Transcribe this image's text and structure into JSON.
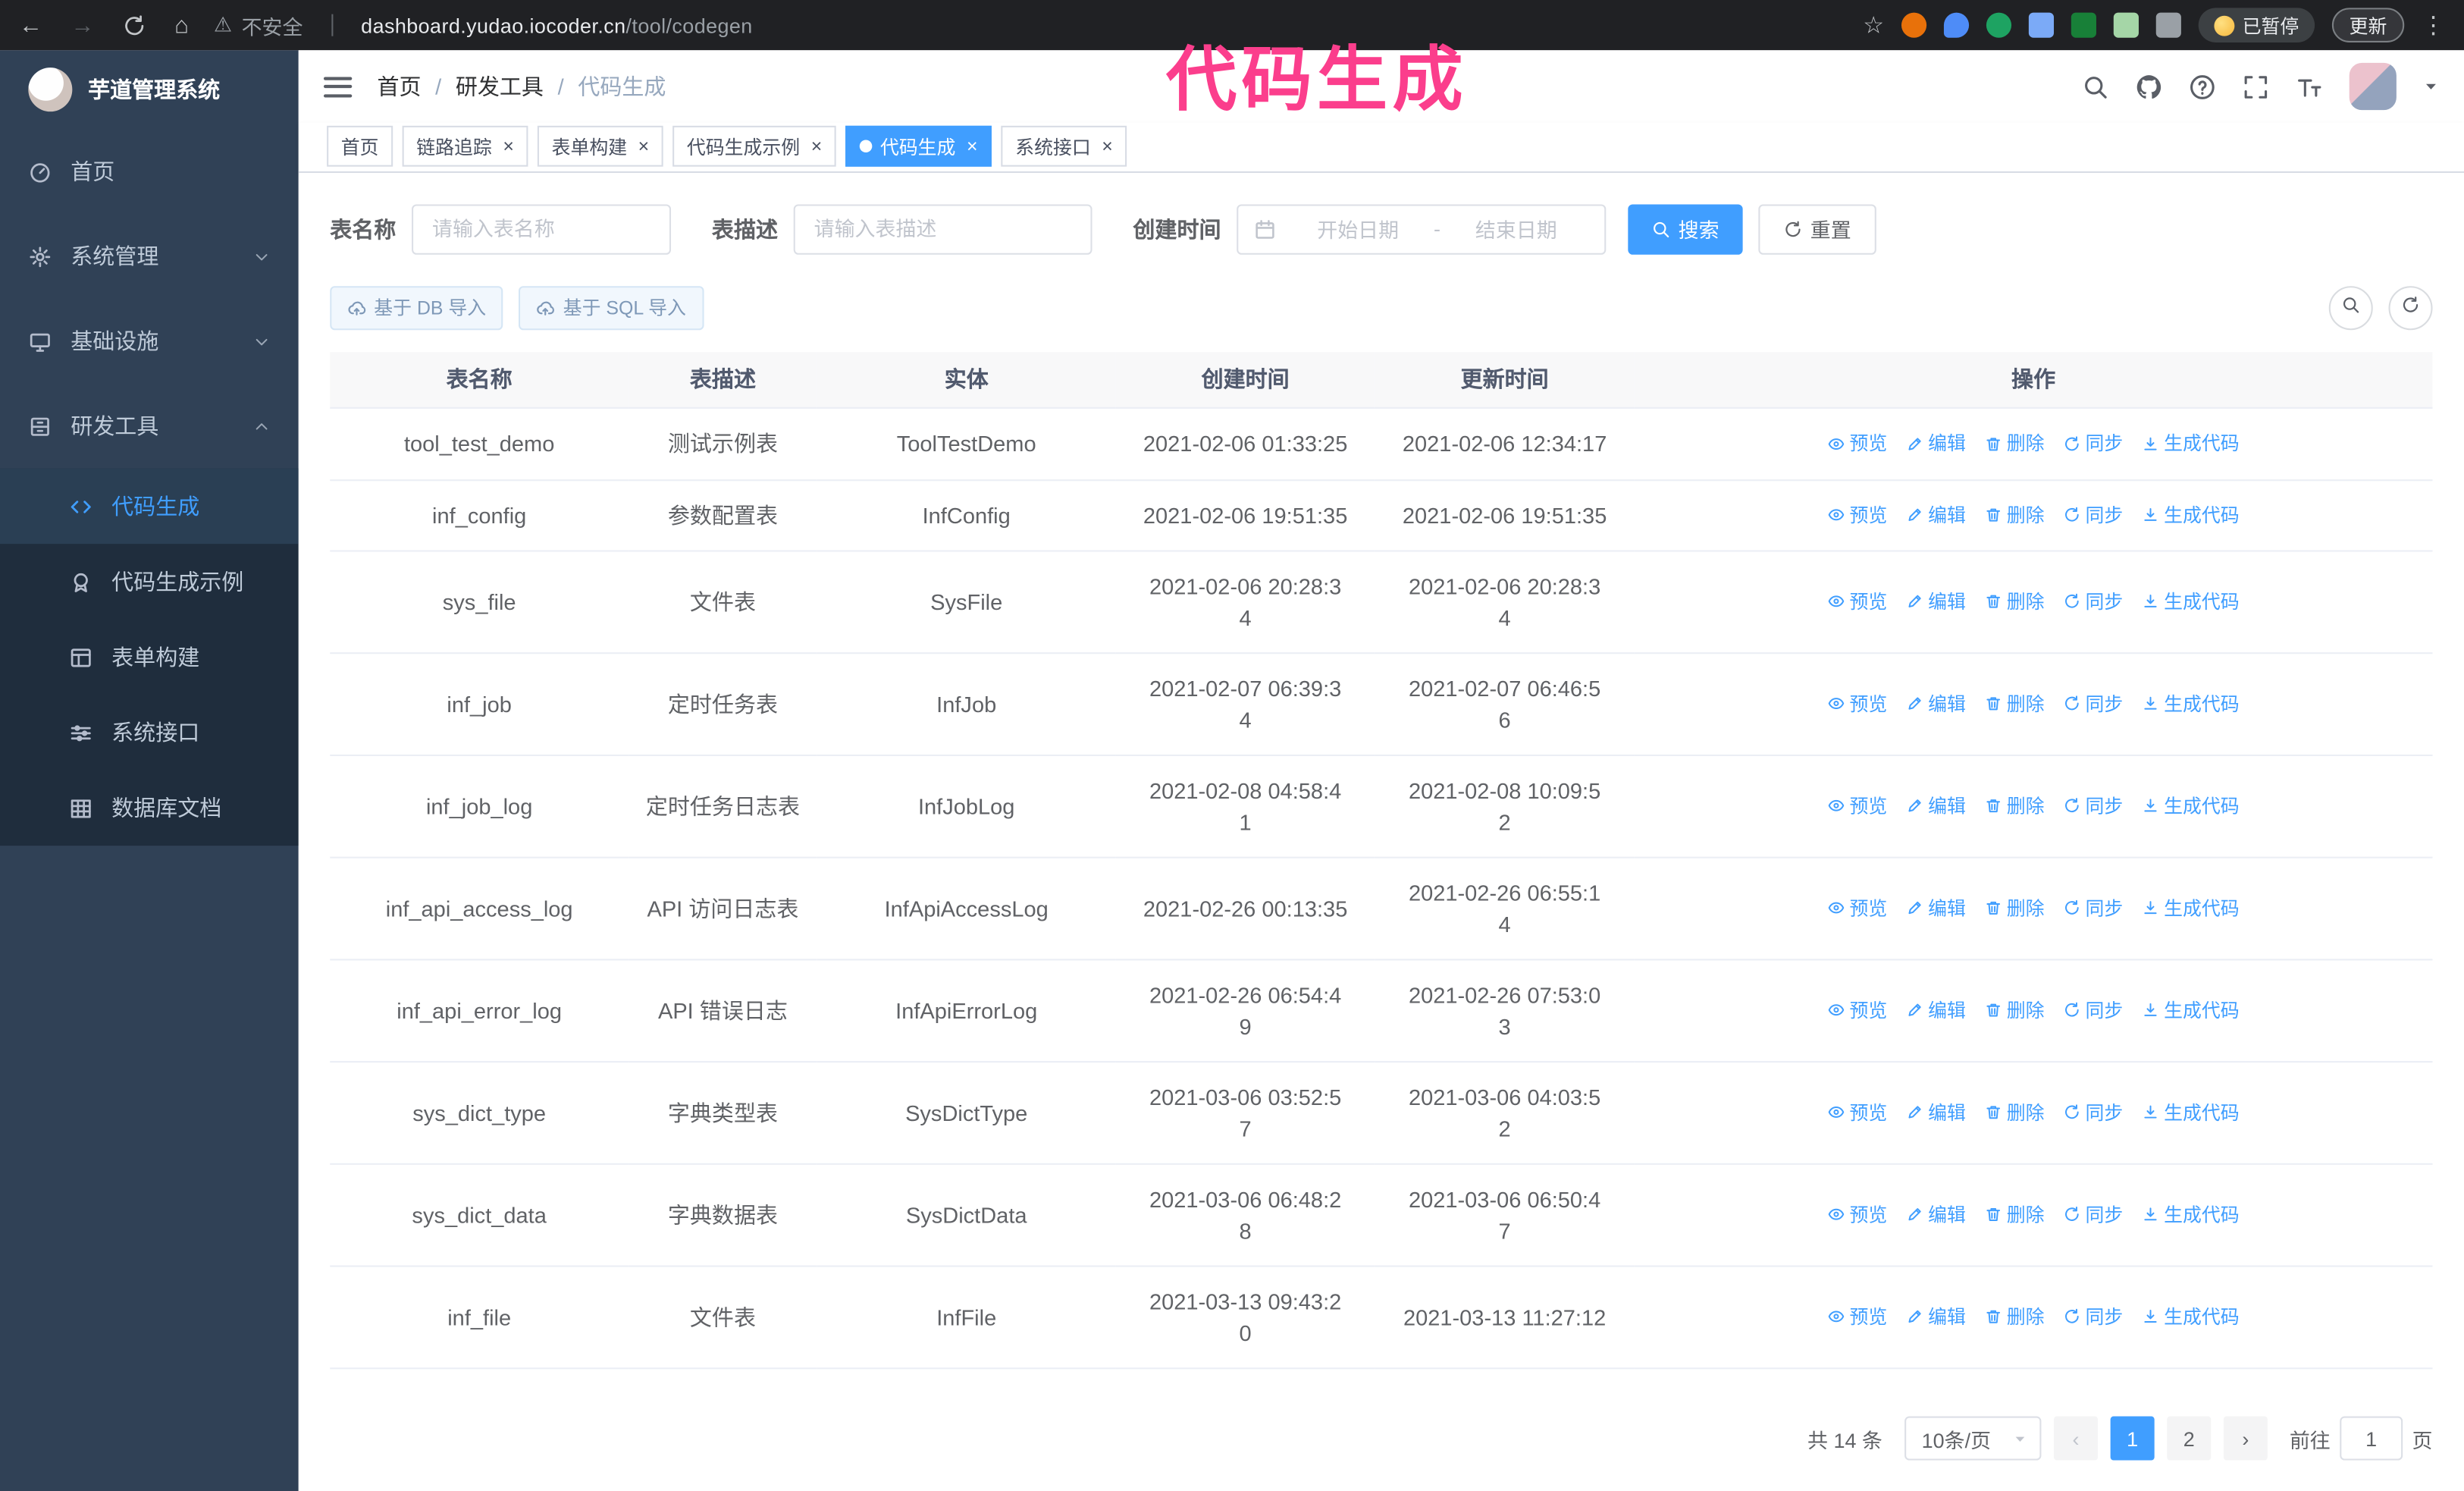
{
  "colors": {
    "accent": "#409eff",
    "sidebar_bg": "#304156",
    "submenu_bg": "#1f2d3d",
    "chrome_bg": "#202124",
    "overlay_pink": "#fb3e8c",
    "tag_active": "#409eff"
  },
  "overlay": {
    "text": "代码生成"
  },
  "browser": {
    "security_label": "不安全",
    "url_host": "dashboard.yudao.iocoder.cn",
    "url_path": "/tool/codegen",
    "paused_badge": "已暂停",
    "update_button": "更新",
    "chrome_icons": [
      "back-icon",
      "forward-icon",
      "reload-icon",
      "home-icon",
      "warning-icon",
      "bookmark-star-icon",
      "extension-icons",
      "menu-dots-icon"
    ]
  },
  "sidebar": {
    "logo_title": "芋道管理系统",
    "items": [
      {
        "label": "首页",
        "icon": "dashboard-icon",
        "arrow": ""
      },
      {
        "label": "系统管理",
        "icon": "gear-icon",
        "arrow": "down"
      },
      {
        "label": "基础设施",
        "icon": "infra-icon",
        "arrow": "down"
      },
      {
        "label": "研发工具",
        "icon": "tools-icon",
        "arrow": "up"
      }
    ],
    "sub_items": [
      {
        "label": "代码生成",
        "icon": "code-icon",
        "active": true
      },
      {
        "label": "代码生成示例",
        "icon": "example-icon",
        "active": false
      },
      {
        "label": "表单构建",
        "icon": "form-icon",
        "active": false
      },
      {
        "label": "系统接口",
        "icon": "api-icon",
        "active": false
      },
      {
        "label": "数据库文档",
        "icon": "dbdoc-icon",
        "active": false
      }
    ]
  },
  "header": {
    "icons": [
      "search-icon",
      "github-icon",
      "question-icon",
      "fullscreen-icon",
      "fontsize-icon",
      "caret-down-icon"
    ]
  },
  "breadcrumb": {
    "items": [
      "首页",
      "研发工具",
      "代码生成"
    ],
    "separator": "/"
  },
  "tags": [
    {
      "label": "首页",
      "closable": false,
      "active": false
    },
    {
      "label": "链路追踪",
      "closable": true,
      "active": false
    },
    {
      "label": "表单构建",
      "closable": true,
      "active": false
    },
    {
      "label": "代码生成示例",
      "closable": true,
      "active": false
    },
    {
      "label": "代码生成",
      "closable": true,
      "active": true
    },
    {
      "label": "系统接口",
      "closable": true,
      "active": false
    }
  ],
  "filters": {
    "name_label": "表名称",
    "name_placeholder": "请输入表名称",
    "desc_label": "表描述",
    "desc_placeholder": "请输入表描述",
    "time_label": "创建时间",
    "start_placeholder": "开始日期",
    "separator": "-",
    "end_placeholder": "结束日期",
    "search_label": "搜索",
    "reset_label": "重置"
  },
  "toolbar": {
    "import_db_label": "基于 DB 导入",
    "import_sql_label": "基于 SQL 导入",
    "right_icons": [
      "search-icon",
      "refresh-icon"
    ]
  },
  "table": {
    "columns": [
      "表名称",
      "表描述",
      "实体",
      "创建时间",
      "更新时间",
      "操作"
    ],
    "op_labels": [
      "预览",
      "编辑",
      "删除",
      "同步",
      "生成代码"
    ],
    "op_icons": [
      "eye-icon",
      "edit-icon",
      "delete-icon",
      "sync-icon",
      "download-icon"
    ],
    "rows": [
      {
        "name": "tool_test_demo",
        "desc": "测试示例表",
        "entity": "ToolTestDemo",
        "created": "2021-02-06 01:33:25",
        "updated": "2021-02-06 12:34:17"
      },
      {
        "name": "inf_config",
        "desc": "参数配置表",
        "entity": "InfConfig",
        "created": "2021-02-06 19:51:35",
        "updated": "2021-02-06 19:51:35"
      },
      {
        "name": "sys_file",
        "desc": "文件表",
        "entity": "SysFile",
        "created": "2021-02-06 20:28:3\n4",
        "updated": "2021-02-06 20:28:3\n4"
      },
      {
        "name": "inf_job",
        "desc": "定时任务表",
        "entity": "InfJob",
        "created": "2021-02-07 06:39:3\n4",
        "updated": "2021-02-07 06:46:5\n6"
      },
      {
        "name": "inf_job_log",
        "desc": "定时任务日志表",
        "entity": "InfJobLog",
        "created": "2021-02-08 04:58:4\n1",
        "updated": "2021-02-08 10:09:5\n2"
      },
      {
        "name": "inf_api_access_log",
        "desc": "API 访问日志表",
        "entity": "InfApiAccessLog",
        "created": "2021-02-26 00:13:35",
        "updated": "2021-02-26 06:55:1\n4"
      },
      {
        "name": "inf_api_error_log",
        "desc": "API 错误日志",
        "entity": "InfApiErrorLog",
        "created": "2021-02-26 06:54:4\n9",
        "updated": "2021-02-26 07:53:0\n3"
      },
      {
        "name": "sys_dict_type",
        "desc": "字典类型表",
        "entity": "SysDictType",
        "created": "2021-03-06 03:52:5\n7",
        "updated": "2021-03-06 04:03:5\n2"
      },
      {
        "name": "sys_dict_data",
        "desc": "字典数据表",
        "entity": "SysDictData",
        "created": "2021-03-06 06:48:2\n8",
        "updated": "2021-03-06 06:50:4\n7"
      },
      {
        "name": "inf_file",
        "desc": "文件表",
        "entity": "InfFile",
        "created": "2021-03-13 09:43:2\n0",
        "updated": "2021-03-13 11:27:12"
      }
    ]
  },
  "pagination": {
    "total": "共 14 条",
    "page_size": "10条/页",
    "pages": [
      "1",
      "2"
    ],
    "active_page": "1",
    "prev_icon": "chevron-left-icon",
    "next_icon": "chevron-right-icon",
    "goto_label": "前往",
    "goto_value": "1",
    "goto_suffix": "页"
  }
}
